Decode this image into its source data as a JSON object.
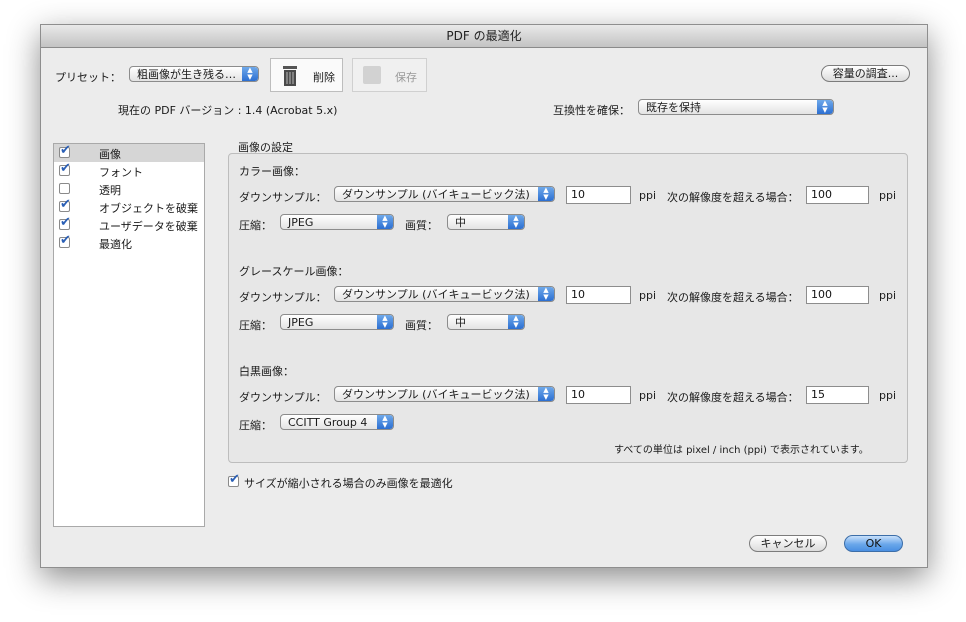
{
  "window": {
    "title": "PDF の最適化"
  },
  "top": {
    "preset_label": "プリセット：",
    "preset_value": "粗画像が生き残る…",
    "delete_label": "削除",
    "save_label": "保存",
    "audit_label": "容量の調査...",
    "current_version": "現在の PDF バージョン : 1.4 (Acrobat 5.x)",
    "compat_label": "互換性を確保：",
    "compat_value": "既存を保持"
  },
  "sidebar": {
    "items": [
      {
        "label": "画像",
        "checked": true
      },
      {
        "label": "フォント",
        "checked": true
      },
      {
        "label": "透明",
        "checked": false
      },
      {
        "label": "オブジェクトを破棄",
        "checked": true
      },
      {
        "label": "ユーザデータを破棄",
        "checked": true
      },
      {
        "label": "最適化",
        "checked": true
      }
    ]
  },
  "image_settings": {
    "title": "画像の設定",
    "color": {
      "heading": "カラー画像：",
      "downsample_label": "ダウンサンプル：",
      "downsample_value": "ダウンサンプル (バイキュービック法)",
      "ppi": "10",
      "ppi_unit": "ppi",
      "above_label": "次の解像度を超える場合：",
      "above_value": "100",
      "above_unit": "ppi",
      "compression_label": "圧縮：",
      "compression_value": "JPEG",
      "quality_label": "画質：",
      "quality_value": "中"
    },
    "gray": {
      "heading": "グレースケール画像：",
      "downsample_label": "ダウンサンプル：",
      "downsample_value": "ダウンサンプル (バイキュービック法)",
      "ppi": "10",
      "ppi_unit": "ppi",
      "above_label": "次の解像度を超える場合：",
      "above_value": "100",
      "above_unit": "ppi",
      "compression_label": "圧縮：",
      "compression_value": "JPEG",
      "quality_label": "画質：",
      "quality_value": "中"
    },
    "mono": {
      "heading": "白黒画像：",
      "downsample_label": "ダウンサンプル：",
      "downsample_value": "ダウンサンプル (バイキュービック法)",
      "ppi": "10",
      "ppi_unit": "ppi",
      "above_label": "次の解像度を超える場合：",
      "above_value": "15",
      "above_unit": "ppi",
      "compression_label": "圧縮：",
      "compression_value": "CCITT Group 4"
    },
    "units_note": "すべての単位は pixel / inch (ppi) で表示されています。"
  },
  "optimize_only_label": "サイズが縮小される場合のみ画像を最適化",
  "buttons": {
    "cancel": "キャンセル",
    "ok": "OK"
  },
  "colors": {
    "accent": "#4a8fe2",
    "window_bg": "#ececec"
  }
}
